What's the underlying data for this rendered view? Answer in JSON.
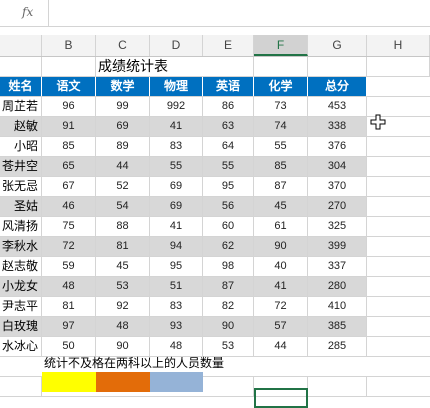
{
  "formula_bar": {
    "fx_label": "fx",
    "value": ""
  },
  "columns": [
    "B",
    "C",
    "D",
    "E",
    "F",
    "G",
    "H"
  ],
  "selected_column": "F",
  "title": "成绩统计表",
  "headers": [
    "姓名",
    "语文",
    "数学",
    "物理",
    "英语",
    "化学",
    "总分"
  ],
  "rows": [
    [
      "周芷若",
      "96",
      "99",
      "992",
      "86",
      "73",
      "453"
    ],
    [
      "赵敏",
      "91",
      "69",
      "41",
      "63",
      "74",
      "338"
    ],
    [
      "小昭",
      "85",
      "89",
      "83",
      "64",
      "55",
      "376"
    ],
    [
      "苍井空",
      "65",
      "44",
      "55",
      "55",
      "85",
      "304"
    ],
    [
      "张无忌",
      "67",
      "52",
      "69",
      "95",
      "87",
      "370"
    ],
    [
      "圣姑",
      "46",
      "54",
      "69",
      "56",
      "45",
      "270"
    ],
    [
      "风清扬",
      "75",
      "88",
      "41",
      "60",
      "61",
      "325"
    ],
    [
      "李秋水",
      "72",
      "81",
      "94",
      "62",
      "90",
      "399"
    ],
    [
      "赵志敬",
      "59",
      "45",
      "95",
      "98",
      "40",
      "337"
    ],
    [
      "小龙女",
      "48",
      "53",
      "51",
      "87",
      "41",
      "280"
    ],
    [
      "尹志平",
      "81",
      "92",
      "83",
      "82",
      "72",
      "410"
    ],
    [
      "白玫瑰",
      "97",
      "48",
      "93",
      "90",
      "57",
      "385"
    ],
    [
      "水冰心",
      "50",
      "90",
      "48",
      "53",
      "44",
      "285"
    ]
  ],
  "note": "统计不及格在两科以上的人员数量",
  "swatches": {
    "yellow": "#ffff00",
    "orange": "#e36c09",
    "blue": "#95b3d7"
  },
  "colors": {
    "header_bg": "#0070c0",
    "band_gray": "#d8d8d8",
    "selection": "#217346"
  }
}
